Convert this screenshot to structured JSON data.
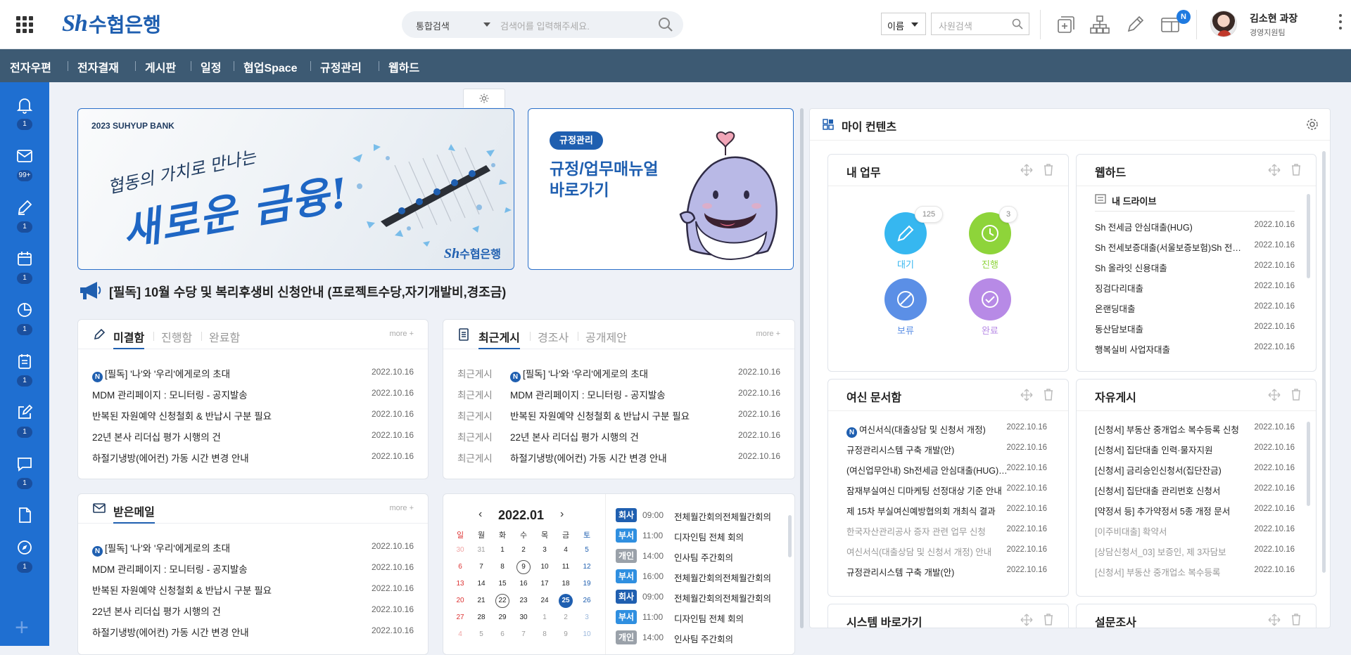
{
  "header": {
    "brand_sh": "Sh",
    "brand_name": "수협은행",
    "search_scope": "통합검색",
    "search_placeholder": "검색어를 입력해주세요.",
    "emp_select": "이름",
    "emp_placeholder": "사원검색",
    "notification_badge": "N",
    "user_name": "김소현 과장",
    "user_dept": "경영지원팀"
  },
  "menu": [
    "전자우편",
    "전자결재",
    "게시판",
    "일정",
    "협업Space",
    "규정관리",
    "웹하드"
  ],
  "sidebar": [
    {
      "icon": "bell-icon",
      "badge": "1"
    },
    {
      "icon": "mail-icon",
      "badge": "99+"
    },
    {
      "icon": "pen-icon",
      "badge": "1"
    },
    {
      "icon": "calendar-icon",
      "badge": "1"
    },
    {
      "icon": "pie-chart-icon",
      "badge": "1"
    },
    {
      "icon": "clipboard-icon",
      "badge": "1"
    },
    {
      "icon": "edit-icon",
      "badge": "1"
    },
    {
      "icon": "chat-icon",
      "badge": "1"
    },
    {
      "icon": "document-icon",
      "badge": ""
    },
    {
      "icon": "compass-icon",
      "badge": "1"
    }
  ],
  "banner1": {
    "year": "2023 SUHYUP BANK",
    "slogan_sub": "협동의 가치로 만나는",
    "slogan_main": "새로운 금융!",
    "logo_sh": "Sh",
    "logo_name": "수협은행"
  },
  "banner2": {
    "tag": "규정관리",
    "line1": "규정/업무매뉴얼",
    "line2": "바로가기"
  },
  "notice": "[필독] 10월 수당 및 복리후생비 신청안내 (프로젝트수당,자기개발비,경조금)",
  "approval": {
    "tabs": [
      "미결함",
      "진행함",
      "완료함"
    ],
    "more": "more +",
    "rows": [
      {
        "n": "N",
        "title": "[필독] '나'와 '우리'에게로의 초대",
        "date": "2022.10.16"
      },
      {
        "n": "",
        "title": "MDM 관리페이지 : 모니터링 - 공지발송",
        "date": "2022.10.16"
      },
      {
        "n": "",
        "title": "반복된 자원예약 신청철회 & 반납시 구분 필요",
        "date": "2022.10.16"
      },
      {
        "n": "",
        "title": "22년 본사 리더십 평가 시행의 건",
        "date": "2022.10.16"
      },
      {
        "n": "",
        "title": "하절기냉방(에어컨) 가동 시간 변경 안내",
        "date": "2022.10.16"
      }
    ]
  },
  "board": {
    "tabs": [
      "최근게시",
      "경조사",
      "공개제안"
    ],
    "more": "more +",
    "rows": [
      {
        "cat": "최근게시",
        "n": "N",
        "title": "[필독] '나'와 '우리'에게로의 초대",
        "date": "2022.10.16"
      },
      {
        "cat": "최근게시",
        "n": "",
        "title": "MDM 관리페이지 : 모니터링 - 공지발송",
        "date": "2022.10.16"
      },
      {
        "cat": "최근게시",
        "n": "",
        "title": "반복된 자원예약 신청철회 & 반납시 구분 필요",
        "date": "2022.10.16"
      },
      {
        "cat": "최근게시",
        "n": "",
        "title": "22년 본사 리더십 평가 시행의 건",
        "date": "2022.10.16"
      },
      {
        "cat": "최근게시",
        "n": "",
        "title": "하절기냉방(에어컨) 가동 시간 변경 안내",
        "date": "2022.10.16"
      }
    ]
  },
  "inbox": {
    "title": "받은메일",
    "more": "more +",
    "rows": [
      {
        "n": "N",
        "title": "[필독] '나'와 '우리'에게로의 초대",
        "date": "2022.10.16"
      },
      {
        "n": "",
        "title": "MDM 관리페이지 : 모니터링 - 공지발송",
        "date": "2022.10.16"
      },
      {
        "n": "",
        "title": "반복된 자원예약 신청철회 & 반납시 구분 필요",
        "date": "2022.10.16"
      },
      {
        "n": "",
        "title": "22년 본사 리더십 평가 시행의 건",
        "date": "2022.10.16"
      },
      {
        "n": "",
        "title": "하절기냉방(에어컨) 가동 시간 변경 안내",
        "date": "2022.10.16"
      }
    ]
  },
  "calendar": {
    "prev": "‹",
    "next": "›",
    "month": "2022.01",
    "weekdays": [
      "일",
      "월",
      "화",
      "수",
      "목",
      "금",
      "토"
    ],
    "weeks": [
      [
        "30",
        "31",
        "1",
        "2",
        "3",
        "4",
        "5"
      ],
      [
        "6",
        "7",
        "8",
        "9",
        "10",
        "11",
        "12"
      ],
      [
        "13",
        "14",
        "15",
        "16",
        "17",
        "18",
        "19"
      ],
      [
        "20",
        "21",
        "22",
        "23",
        "24",
        "25",
        "26"
      ],
      [
        "27",
        "28",
        "29",
        "30",
        "1",
        "2",
        "3"
      ],
      [
        "4",
        "5",
        "6",
        "7",
        "8",
        "9",
        "10"
      ]
    ],
    "events": [
      {
        "kind": "회사",
        "color": "#1f5fb0",
        "time": "09:00",
        "title": "전체월간회의전체월간회의"
      },
      {
        "kind": "부서",
        "color": "#2f8fe0",
        "time": "11:00",
        "title": "디자인팀 전체 회의"
      },
      {
        "kind": "개인",
        "color": "#9aa1a9",
        "time": "14:00",
        "title": "인사팀 주간회의"
      },
      {
        "kind": "부서",
        "color": "#2f8fe0",
        "time": "16:00",
        "title": "전체월간회의전체월간회의"
      },
      {
        "kind": "회사",
        "color": "#1f5fb0",
        "time": "09:00",
        "title": "전체월간회의전체월간회의"
      },
      {
        "kind": "부서",
        "color": "#2f8fe0",
        "time": "11:00",
        "title": "디자인팀 전체 회의"
      },
      {
        "kind": "개인",
        "color": "#9aa1a9",
        "time": "14:00",
        "title": "인사팀 주간회의"
      }
    ]
  },
  "my_contents": {
    "title": "마이 컨텐츠",
    "my_work": {
      "title": "내 업무",
      "items": [
        {
          "label": "대기",
          "count": "125",
          "color": "#36b7f0"
        },
        {
          "label": "진행",
          "count": "3",
          "color": "#8ed43a"
        },
        {
          "label": "보류",
          "count": "",
          "color": "#5b8fe6"
        },
        {
          "label": "완료",
          "count": "",
          "color": "#b78ae6"
        }
      ]
    },
    "webhard": {
      "title": "웹하드",
      "drive": "내 드라이브",
      "rows": [
        {
          "title": "Sh 전세금 안심대출(HUG)",
          "date": "2022.10.16"
        },
        {
          "title": "Sh 전세보증대출(서울보증보험)Sh 전세보증대출",
          "date": "2022.10.16"
        },
        {
          "title": "Sh 올라잇 신용대출",
          "date": "2022.10.16"
        },
        {
          "title": "징검다리대출",
          "date": "2022.10.16"
        },
        {
          "title": "온랜딩대출",
          "date": "2022.10.16"
        },
        {
          "title": "동산담보대출",
          "date": "2022.10.16"
        },
        {
          "title": "행복실비 사업자대출",
          "date": "2022.10.16"
        }
      ]
    },
    "loan_docs": {
      "title": "여신 문서함",
      "rows": [
        {
          "n": "N",
          "title": "여신서식(대출상담 및 신청서 개정)",
          "date": "2022.10.16",
          "dim": false
        },
        {
          "n": "",
          "title": "규정관리시스템 구축 개발(안)",
          "date": "2022.10.16",
          "dim": false
        },
        {
          "n": "",
          "title": "(여신업무안내) Sh전세금 안심대출(HUG) 변경",
          "date": "2022.10.16",
          "dim": false
        },
        {
          "n": "",
          "title": "잠재부실여신 디마케팅 선정대상 기준 안내",
          "date": "2022.10.16",
          "dim": false
        },
        {
          "n": "",
          "title": "제 15차 부실여신예방협의회 개최식 결과",
          "date": "2022.10.16",
          "dim": false
        },
        {
          "n": "",
          "title": "한국자산관리공사 증자 관련 업무 신청",
          "date": "2022.10.16",
          "dim": true
        },
        {
          "n": "",
          "title": "여신서식(대출상담 및 신청서 개정) 안내",
          "date": "2022.10.16",
          "dim": true
        },
        {
          "n": "",
          "title": "규정관리시스템 구축 개발(안)",
          "date": "2022.10.16",
          "dim": false
        }
      ]
    },
    "free_board": {
      "title": "자유게시",
      "rows": [
        {
          "title": "[신청서] 부동산 중개업소 복수등록 신청",
          "date": "2022.10.16",
          "dim": false
        },
        {
          "title": "[신청서] 집단대출 인력·물자지원",
          "date": "2022.10.16",
          "dim": false
        },
        {
          "title": "[신청서] 금리승인신청서(집단잔금)",
          "date": "2022.10.16",
          "dim": false
        },
        {
          "title": "[신청서] 집단대출 관리번호 신청서",
          "date": "2022.10.16",
          "dim": false
        },
        {
          "title": "[약정서 등] 추가약정서 5종 개정 문서",
          "date": "2022.10.16",
          "dim": false
        },
        {
          "title": "[이주비대출] 확약서",
          "date": "2022.10.16",
          "dim": true
        },
        {
          "title": "[상담신청서_03] 보증인, 제 3자담보",
          "date": "2022.10.16",
          "dim": true
        },
        {
          "title": "[신청서] 부동산 중개업소 복수등록",
          "date": "2022.10.16",
          "dim": true
        }
      ]
    },
    "system_shortcut": {
      "title": "시스템 바로가기"
    },
    "survey": {
      "title": "설문조사"
    }
  }
}
